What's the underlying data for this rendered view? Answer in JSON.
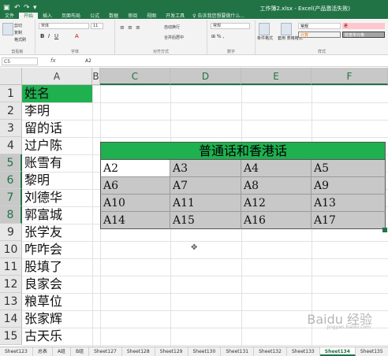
{
  "window": {
    "title": "工作簿2.xlsx - Excel(产品激活失败)",
    "quick_access": [
      "↶",
      "↷",
      "▾"
    ],
    "tabs": [
      "文件",
      "开始",
      "插入",
      "页面布局",
      "公式",
      "数据",
      "审阅",
      "视图",
      "开发工具"
    ],
    "active_tab": "开始",
    "tell_me": "告诉我您想要做什么..."
  },
  "ribbon": {
    "clipboard": {
      "cut": "剪切",
      "copy": "复制",
      "format_painter": "格式刷",
      "label": "剪贴板"
    },
    "font": {
      "name": "宋体",
      "size": "11",
      "label": "字体"
    },
    "alignment": {
      "wrap": "自动换行",
      "merge": "合并后居中",
      "label": "对齐方式"
    },
    "number": {
      "format": "常规",
      "label": "数字"
    },
    "styles": {
      "cond_format": "条件格式",
      "table_format": "套用\n表格格式",
      "label": "样式",
      "style_cells": [
        "常规",
        "差",
        "计算",
        "检查单元格"
      ]
    }
  },
  "formula_bar": {
    "name_box": "C5",
    "fx": "fx",
    "value": "A2"
  },
  "columns": [
    "A",
    "B",
    "C",
    "D",
    "E",
    "F"
  ],
  "rows": [
    "1",
    "2",
    "3",
    "4",
    "5",
    "6",
    "7",
    "8",
    "9",
    "10",
    "11",
    "12",
    "13",
    "14",
    "15"
  ],
  "column_a": [
    "姓名",
    "李明",
    "留的话",
    "过户陈",
    "账雪有",
    "黎明",
    "刘德华",
    "郭富城",
    "张学友",
    "咋咋会",
    "股填了",
    "良家会",
    "粮草位",
    "张家辉",
    "古天乐"
  ],
  "merged_title": "普通话和香港话",
  "data_grid": [
    [
      "A2",
      "A3",
      "A4",
      "A5"
    ],
    [
      "A6",
      "A7",
      "A8",
      "A9"
    ],
    [
      "A10",
      "A11",
      "A12",
      "A13"
    ],
    [
      "A14",
      "A15",
      "A16",
      "A17"
    ]
  ],
  "sheet_tabs": [
    "Sheet123",
    "总表",
    "A组",
    "B组",
    "Sheet127",
    "Sheet128",
    "Sheet129",
    "Sheet130",
    "Sheet131",
    "Sheet132",
    "Sheet133",
    "Sheet134",
    "Sheet135"
  ],
  "active_sheet": "Sheet134",
  "watermark": "Baidu 经验",
  "watermark_sub": "jingyan.baidu.com",
  "colors": {
    "excel_green": "#217346",
    "fill_green": "#1fb050",
    "selection_gray": "#c8c8c8"
  }
}
